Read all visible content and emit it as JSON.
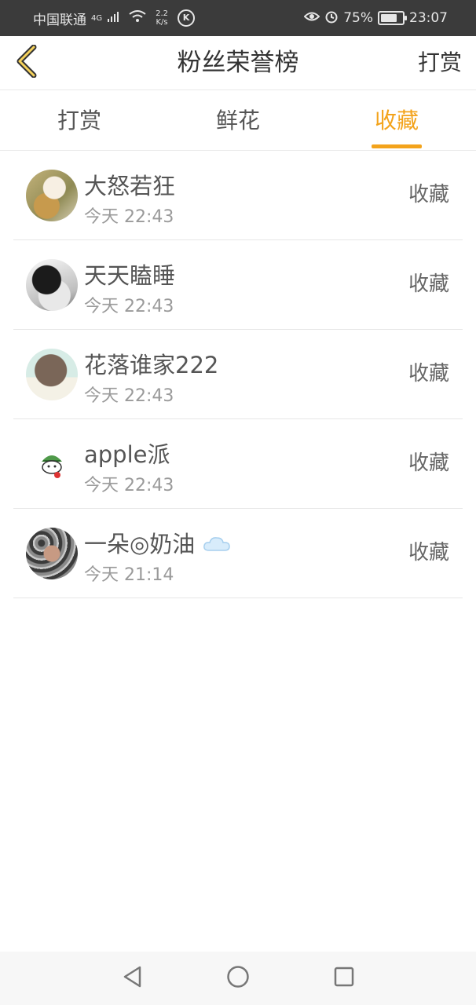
{
  "status_bar": {
    "carrier": "中国联通",
    "network": "4G",
    "speed_value": "2.2",
    "speed_unit": "K/s",
    "k_badge": "K",
    "battery_percent": "75%",
    "battery_level": 0.75,
    "time": "23:07"
  },
  "header": {
    "title": "粉丝荣誉榜",
    "action": "打赏"
  },
  "tabs": [
    {
      "label": "打赏",
      "active": false
    },
    {
      "label": "鲜花",
      "active": false
    },
    {
      "label": "收藏",
      "active": true
    }
  ],
  "list": [
    {
      "name": "大怒若狂",
      "time": "今天 22:43",
      "action": "收藏"
    },
    {
      "name": "天天瞌睡",
      "time": "今天 22:43",
      "action": "收藏"
    },
    {
      "name": "花落谁家222",
      "time": "今天 22:43",
      "action": "收藏"
    },
    {
      "name": "apple派",
      "time": "今天 22:43",
      "action": "收藏"
    },
    {
      "name": "一朵◎奶油",
      "time": "今天 21:14",
      "action": "收藏"
    }
  ],
  "colors": {
    "accent": "#f3a31b",
    "status_bar_bg": "#3b3b3b"
  },
  "icons": {
    "back": "back-chevron-icon",
    "cloud": "cloud-icon",
    "nav_back": "nav-back-triangle-icon",
    "nav_home": "nav-home-circle-icon",
    "nav_recents": "nav-recents-square-icon"
  }
}
